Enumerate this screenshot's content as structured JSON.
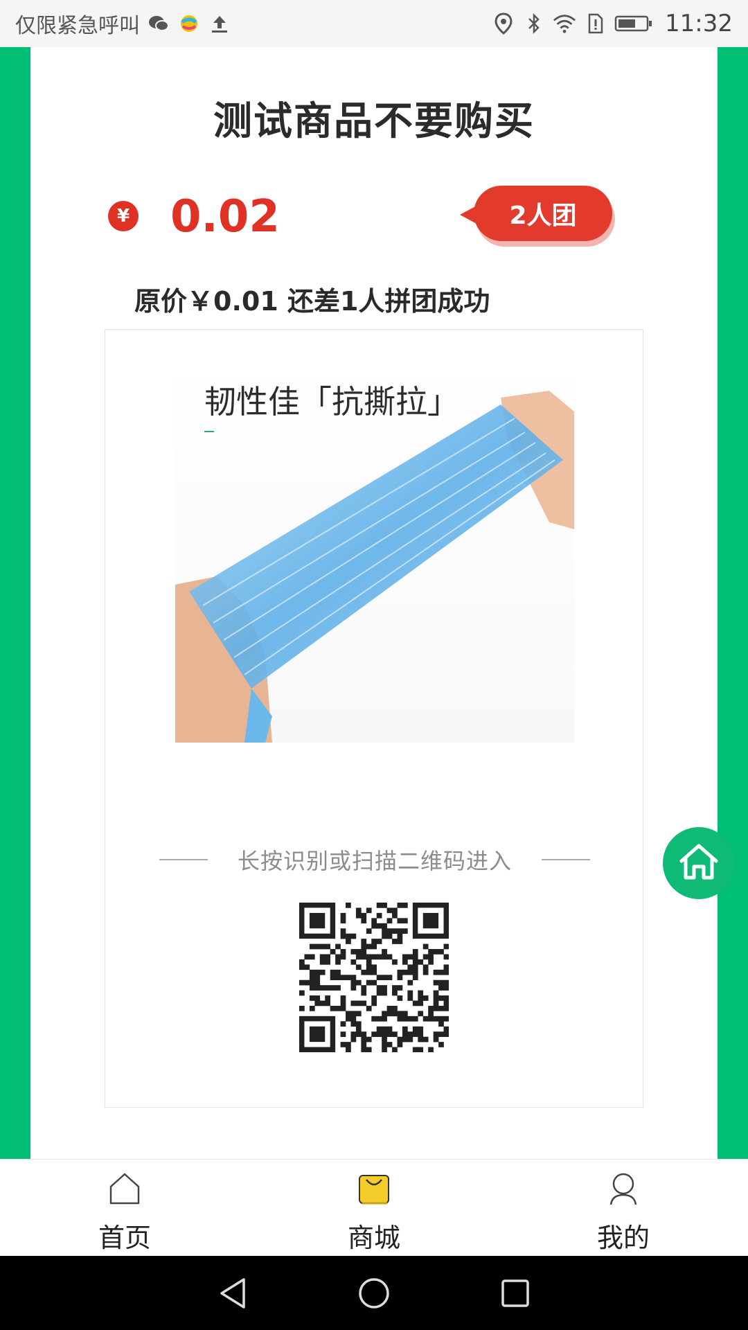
{
  "status_bar": {
    "carrier_text": "仅限紧急呼叫",
    "time": "11:32",
    "left_icons": [
      "wechat-icon",
      "colorful-app-icon",
      "upload-icon"
    ],
    "right_icons": [
      "location-icon",
      "bluetooth-icon",
      "wifi-icon",
      "sim-alert-icon",
      "battery-icon"
    ]
  },
  "poster": {
    "title": "测试商品不要购买",
    "currency_symbol": "¥",
    "price": "0.02",
    "group_badge": "2人团",
    "subtitle": "原价￥0.01 还差1人拼团成功",
    "product_caption": "韧性佳「抗撕拉」",
    "scan_hint": "长按识别或扫描二维码进入"
  },
  "bottom_nav": {
    "items": [
      {
        "label": "首页",
        "icon": "home-outline-icon"
      },
      {
        "label": "商城",
        "icon": "shopping-bag-icon"
      },
      {
        "label": "我的",
        "icon": "user-icon"
      }
    ]
  },
  "colors": {
    "brand_green": "#00bf74",
    "price_red": "#e03125",
    "bag_yellow": "#f5cc2c"
  }
}
